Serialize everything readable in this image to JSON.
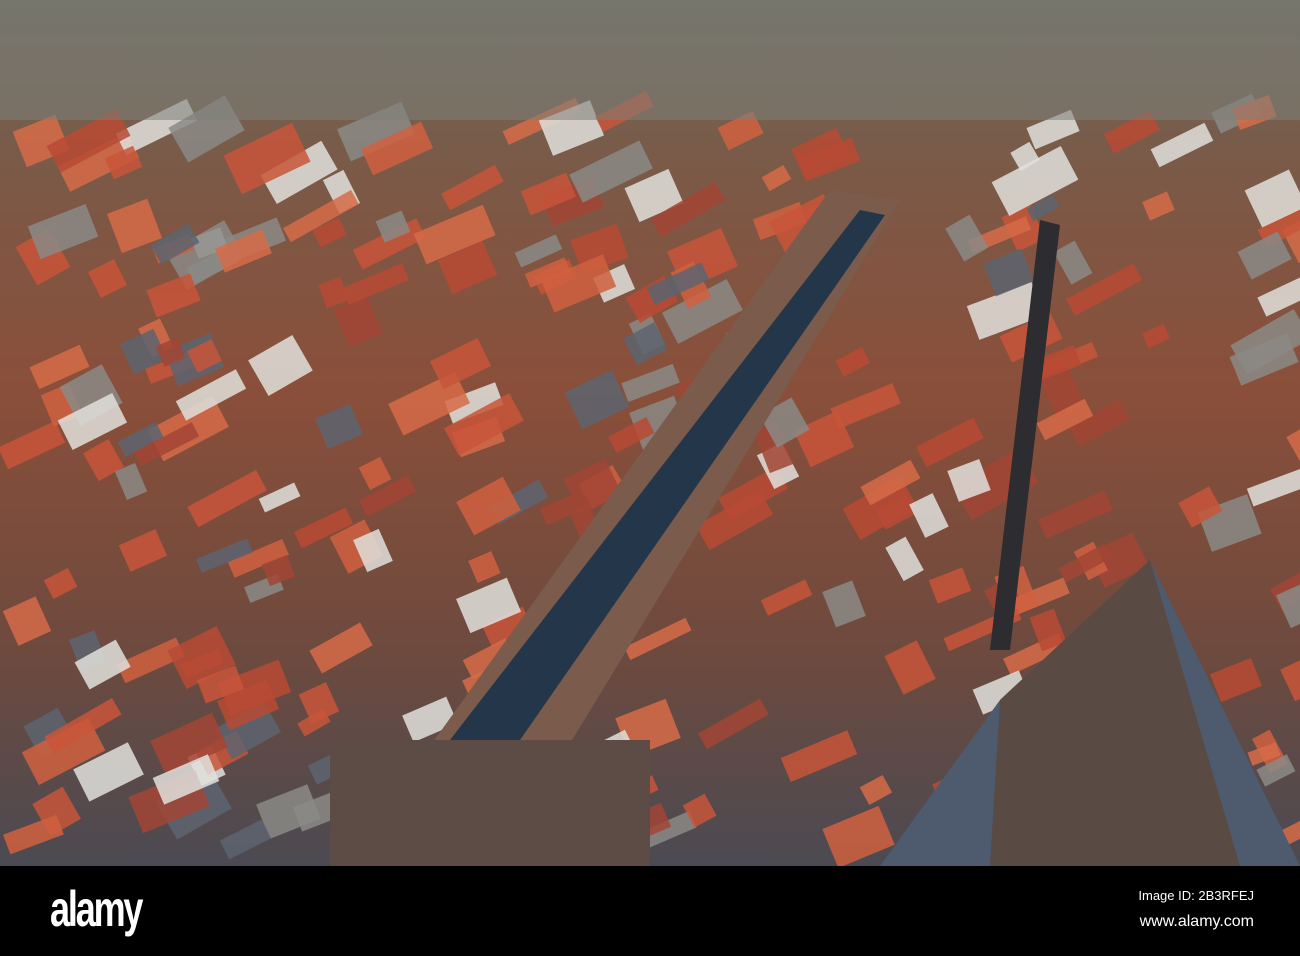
{
  "photo": {
    "subject": "Aerial view of a canal town with red-tiled roofs"
  },
  "watermark_bar": {
    "logo": "alamy",
    "image_id": "Image ID: 2B3RFEJ",
    "website": "www.alamy.com"
  }
}
